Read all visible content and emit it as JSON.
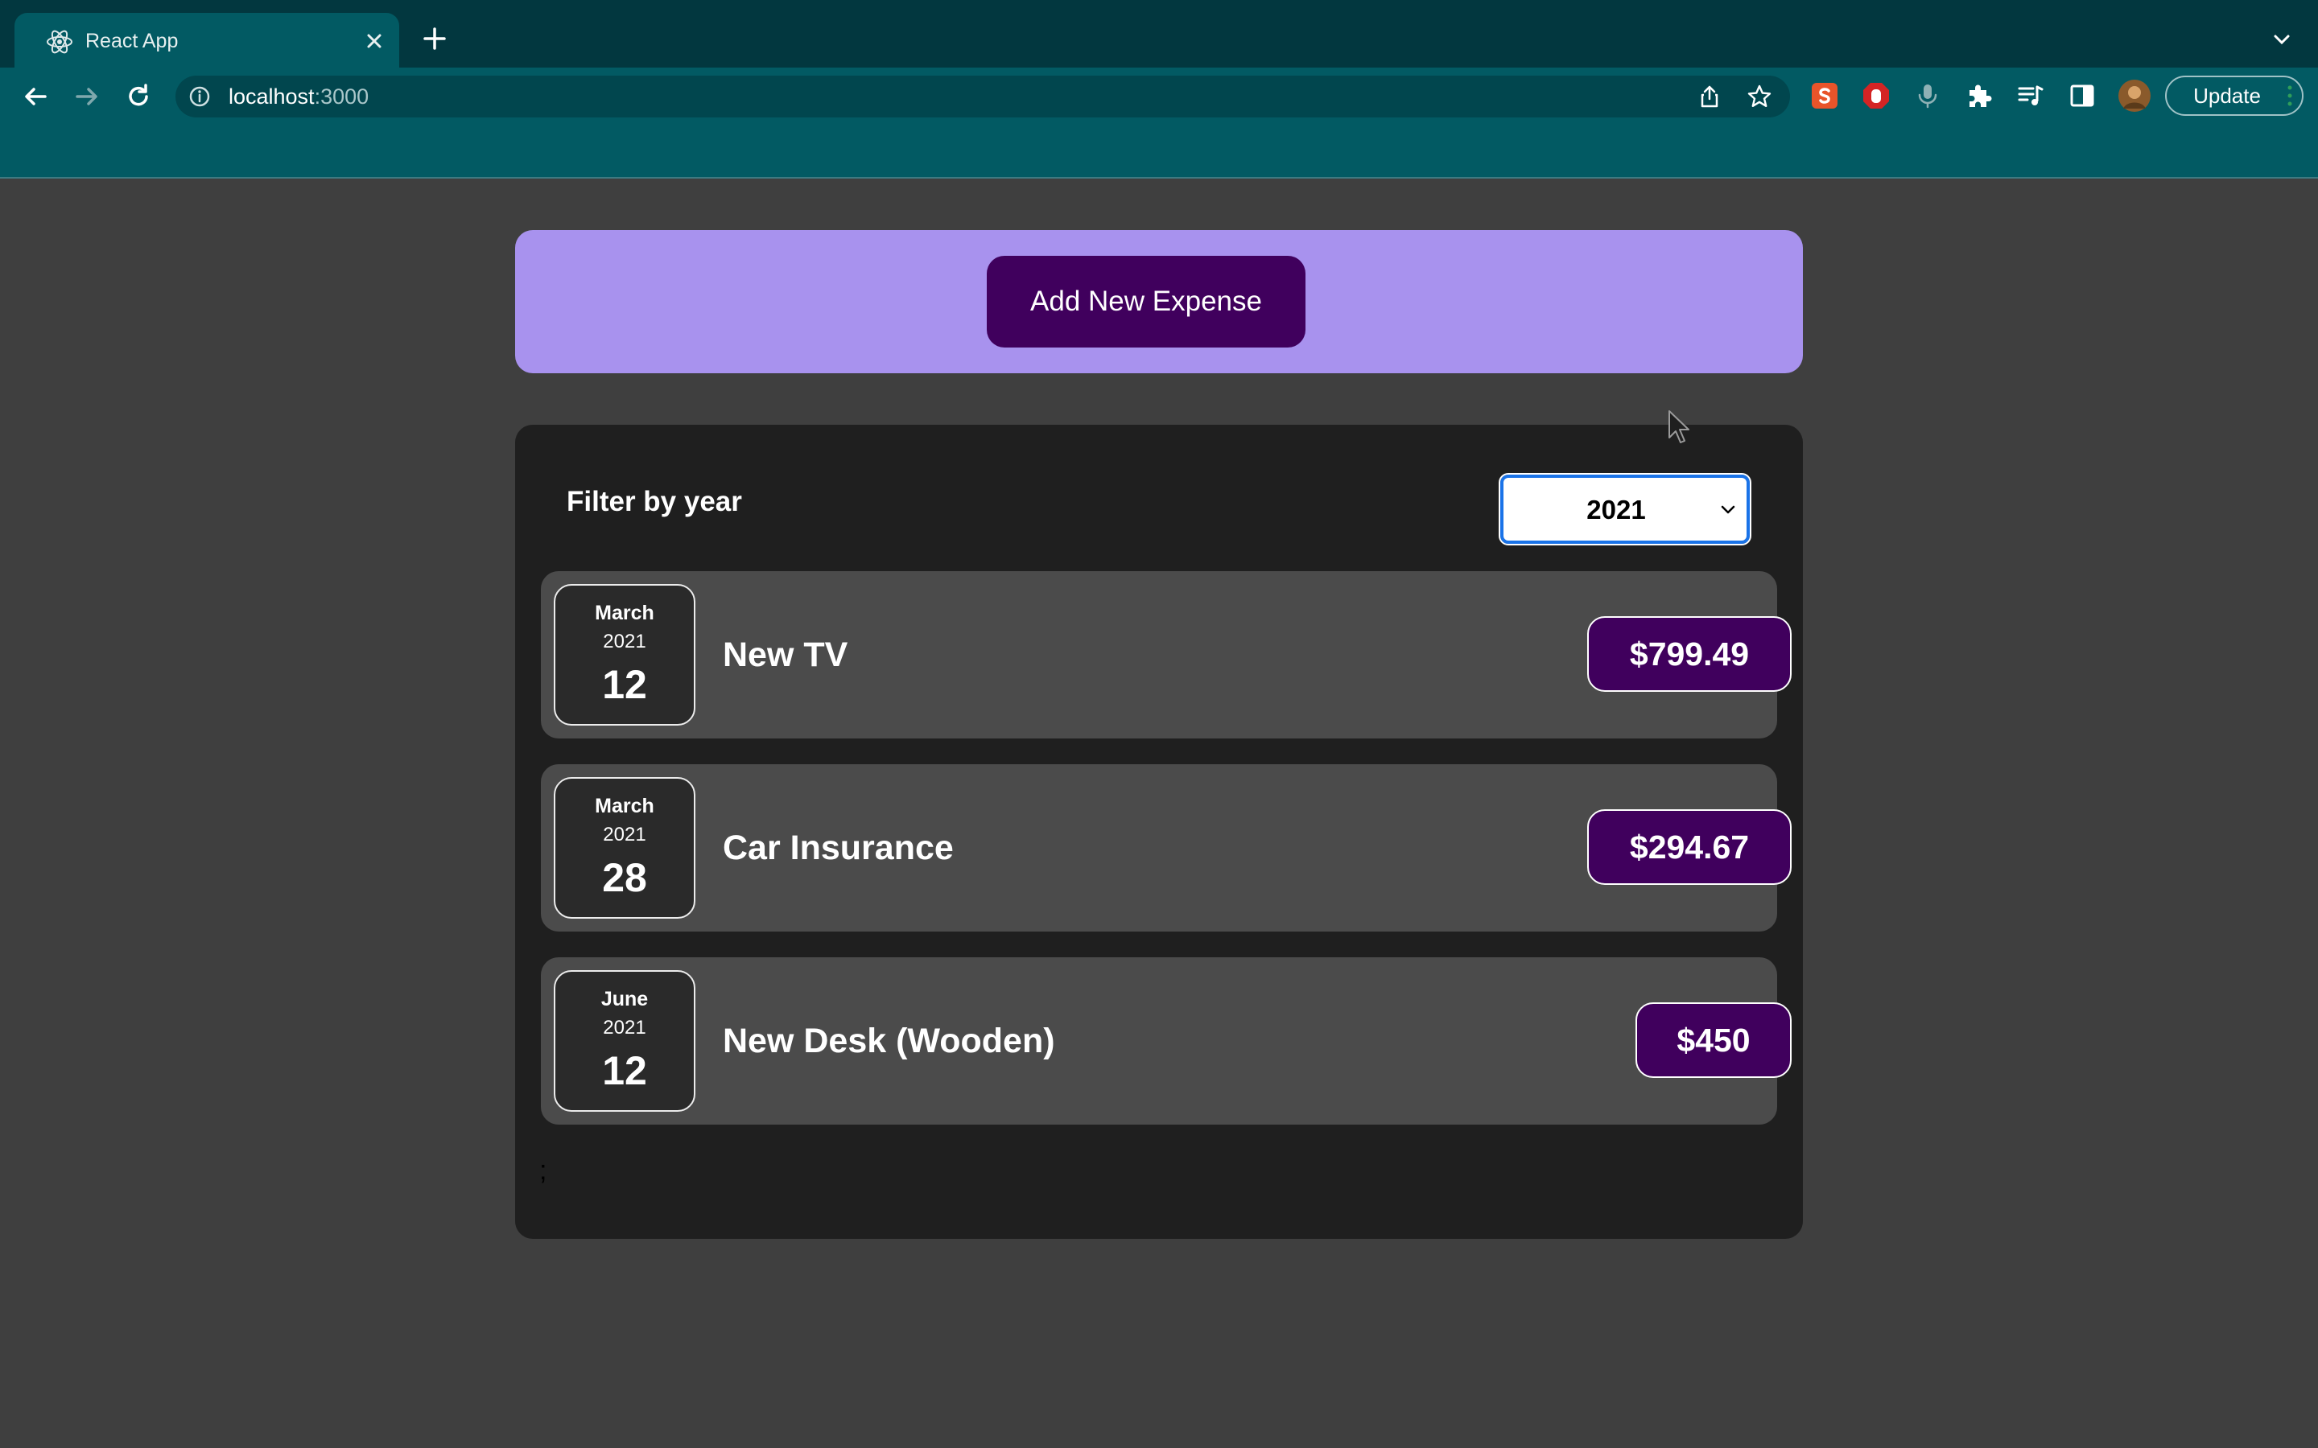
{
  "browser": {
    "tab_title": "React App",
    "url_host": "localhost",
    "url_port": ":3000",
    "update_label": "Update",
    "icons": [
      "react-favicon",
      "close-icon",
      "plus-icon",
      "chevron-down-icon",
      "back-arrow-icon",
      "forward-arrow-icon",
      "reload-icon",
      "info-icon",
      "share-icon",
      "star-icon",
      "extension-s-icon",
      "extension-hand-icon",
      "microphone-icon",
      "puzzle-icon",
      "playlist-icon",
      "sidebar-icon",
      "avatar"
    ]
  },
  "new_expense": {
    "add_button_label": "Add New Expense"
  },
  "filter": {
    "label": "Filter by year",
    "selected_year": "2021"
  },
  "expenses": [
    {
      "month": "March",
      "year": "2021",
      "day": "12",
      "title": "New TV",
      "amount": "$799.49"
    },
    {
      "month": "March",
      "year": "2021",
      "day": "28",
      "title": "Car Insurance",
      "amount": "$294.67"
    },
    {
      "month": "June",
      "year": "2021",
      "day": "12",
      "title": "New Desk (Wooden)",
      "amount": "$450"
    }
  ],
  "stray_text": ";",
  "colors": {
    "page_bg": "#3f3f3f",
    "new_expense_bg": "#a892ee",
    "button_purple": "#40005d",
    "list_bg": "#1f1f1f",
    "item_bg": "#4b4b4b",
    "browser_frame": "#025a63"
  }
}
